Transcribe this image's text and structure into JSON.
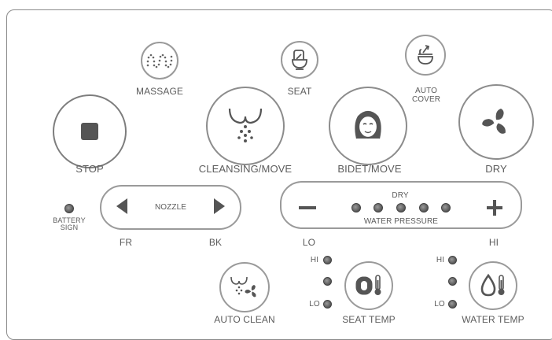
{
  "buttons": {
    "massage": "MASSAGE",
    "seat": "SEAT",
    "auto_cover": "AUTO\nCOVER",
    "stop": "STOP",
    "cleansing_move": "CLEANSING/MOVE",
    "bidet_move": "BIDET/MOVE",
    "dry": "DRY",
    "auto_clean": "AUTO CLEAN",
    "seat_temp": "SEAT TEMP",
    "water_temp": "WATER TEMP"
  },
  "nozzle": {
    "label": "NOZZLE",
    "left_label": "FR",
    "right_label": "BK"
  },
  "battery": {
    "label": "BATTERY\nSIGN"
  },
  "pressure": {
    "top_label": "DRY",
    "label": "WATER PRESSURE",
    "low_label": "LO",
    "high_label": "HI",
    "minus": "−",
    "plus": "+",
    "level_count": 5
  },
  "seat_temp_levels": [
    "HI",
    "",
    "LO"
  ],
  "water_temp_levels": [
    "HI",
    "",
    "LO"
  ],
  "icons": {
    "massage": "wave-icon",
    "seat": "seat-icon",
    "auto_cover": "auto-cover-icon",
    "stop": "stop-square-icon",
    "cleansing": "cleansing-spray-icon",
    "bidet": "woman-face-icon",
    "dry": "fan-icon",
    "auto_clean": "spray-fan-icon",
    "seat_temp": "seat-thermometer-icon",
    "water_temp": "water-drop-thermometer-icon"
  },
  "colors": {
    "outline": "#8c8c8c",
    "text": "#5c5c5c",
    "icon": "#555555",
    "led": "#666666"
  }
}
